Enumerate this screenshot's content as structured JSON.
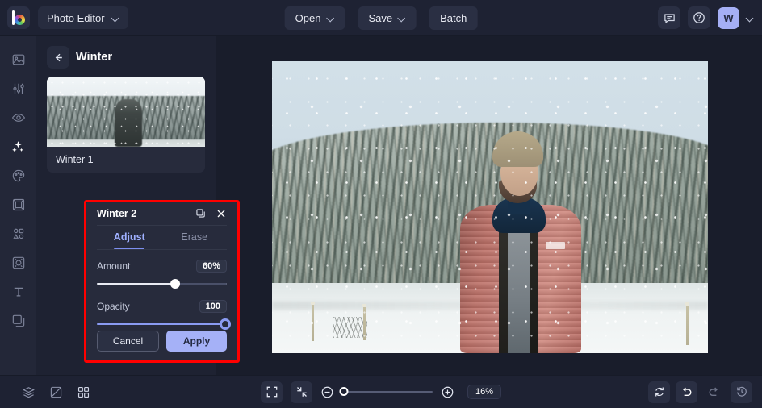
{
  "topbar": {
    "logo_icon": "logo-color-wheel-b",
    "app_switcher_label": "Photo Editor",
    "app_switcher_chevron_icon": "chevron-down-icon",
    "open_label": "Open",
    "open_chevron_icon": "chevron-down-icon",
    "save_label": "Save",
    "save_chevron_icon": "chevron-down-icon",
    "batch_label": "Batch",
    "feedback_icon": "chat-bubble-icon",
    "help_icon": "question-circle-icon",
    "avatar_initial": "W",
    "avatar_chevron_icon": "chevron-down-icon",
    "accent_avatar_color": "#a5aff5"
  },
  "rail": {
    "items": [
      {
        "name": "image",
        "icon": "image-icon",
        "active": false
      },
      {
        "name": "adjust",
        "icon": "sliders-icon",
        "active": false
      },
      {
        "name": "retouch",
        "icon": "eye-icon",
        "active": false
      },
      {
        "name": "effects",
        "icon": "sparkles-icon",
        "active": true
      },
      {
        "name": "color",
        "icon": "palette-icon",
        "active": false
      },
      {
        "name": "frame",
        "icon": "frame-icon",
        "active": false
      },
      {
        "name": "shapes",
        "icon": "shapes-icon",
        "active": false
      },
      {
        "name": "texture",
        "icon": "texture-icon",
        "active": false
      },
      {
        "name": "text",
        "icon": "text-icon",
        "active": false
      },
      {
        "name": "layers",
        "icon": "layers-icon",
        "active": false
      }
    ]
  },
  "panel": {
    "back_icon": "arrow-left-icon",
    "title": "Winter",
    "presets": [
      {
        "label": "Winter 1"
      }
    ]
  },
  "adjust_popover": {
    "title": "Winter 2",
    "duplicate_icon": "copy-icon",
    "close_icon": "close-icon",
    "highlight_color": "#ff0000",
    "tabs": [
      {
        "label": "Adjust",
        "active": true
      },
      {
        "label": "Erase",
        "active": false
      }
    ],
    "controls": [
      {
        "label": "Amount",
        "value": "60%",
        "percent": 60
      },
      {
        "label": "Opacity",
        "value": "100",
        "percent": 100
      }
    ],
    "cancel_label": "Cancel",
    "apply_label": "Apply",
    "apply_color": "#a5b1f7"
  },
  "bottombar": {
    "layers_icon": "layers-stack-icon",
    "compare_icon": "compare-split-icon",
    "grid_icon": "grid-icon",
    "fullscreen_icon": "fullscreen-icon",
    "fit_icon": "fit-to-screen-icon",
    "zoom_out_icon": "minus-circle-icon",
    "zoom_in_icon": "plus-circle-icon",
    "zoom_value": "16%",
    "zoom_slider_percent": 2,
    "reset_icon": "reset-rotate-icon",
    "undo_icon": "undo-icon",
    "redo_icon": "redo-icon",
    "history_icon": "history-clock-icon"
  }
}
